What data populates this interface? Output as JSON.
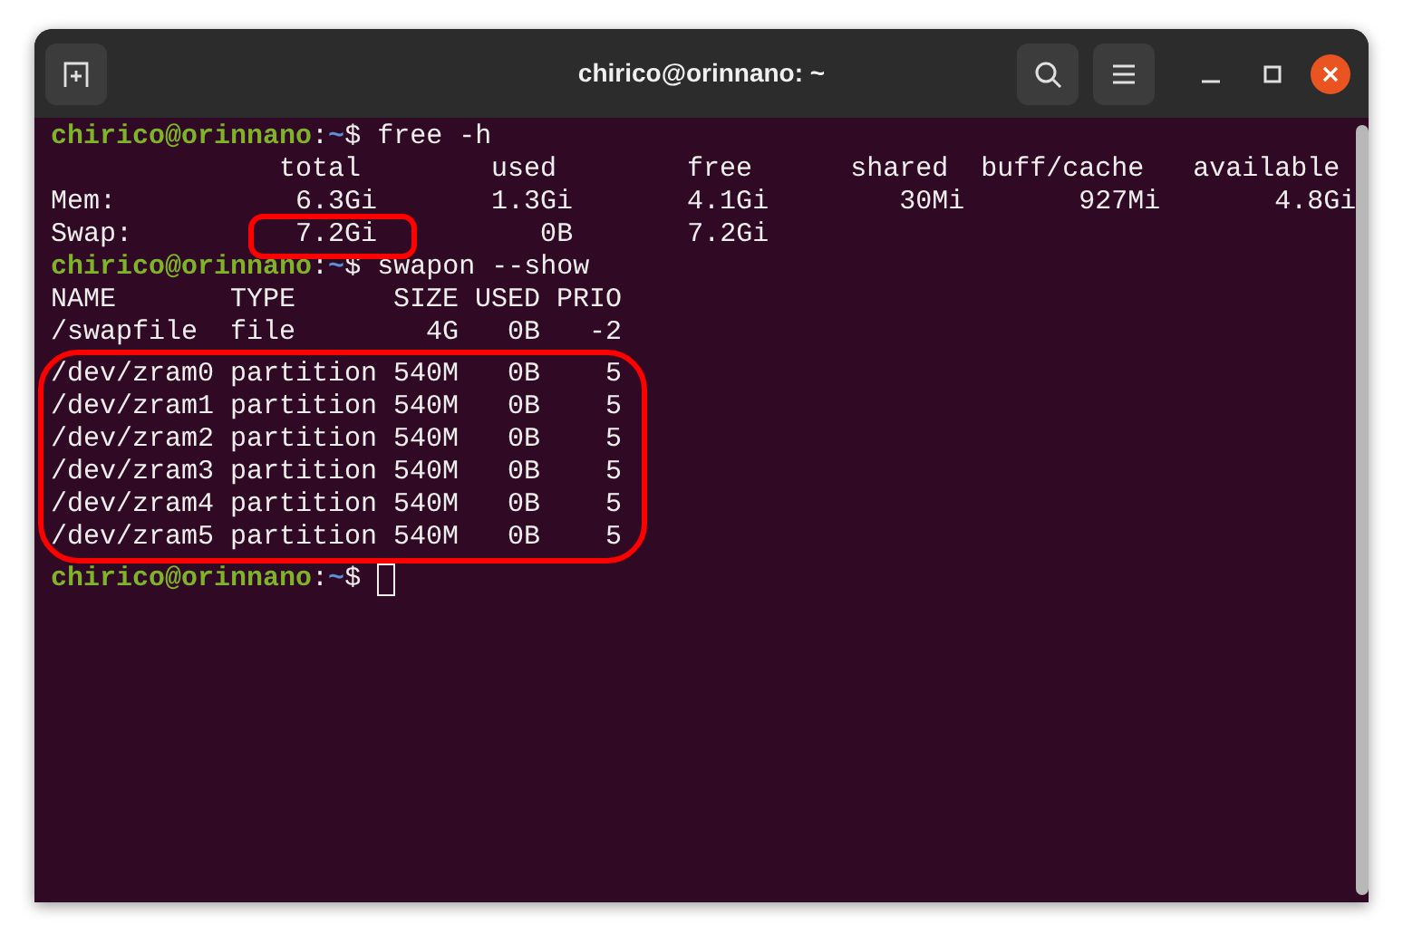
{
  "window": {
    "title": "chirico@orinnano: ~"
  },
  "terminal": {
    "lines": [
      {
        "kind": "prompt",
        "user": "chirico@orinnano",
        "separator": ":",
        "path": "~",
        "symbol": "$",
        "command": " free -h"
      },
      {
        "kind": "output",
        "segments": [
          {
            "text": "              total        used        free      shared  buff/cache   available",
            "circled": false
          }
        ]
      },
      {
        "kind": "output",
        "segments": [
          {
            "text": "Mem:           6.3Gi       1.3Gi       4.1Gi        30Mi       927Mi       4.8Gi",
            "circled": false
          }
        ]
      },
      {
        "kind": "output",
        "segments": [
          {
            "text": "Swap:          ",
            "circled": false
          },
          {
            "text": "7.2Gi",
            "circled": true
          },
          {
            "text": "          0B       7.2Gi",
            "circled": false
          }
        ]
      },
      {
        "kind": "prompt",
        "user": "chirico@orinnano",
        "separator": ":",
        "path": "~",
        "symbol": "$",
        "command": " swapon --show"
      },
      {
        "kind": "output",
        "segments": [
          {
            "text": "NAME       TYPE      SIZE USED PRIO",
            "circled": false
          }
        ]
      },
      {
        "kind": "output",
        "segments": [
          {
            "text": "/swapfile  file        4G   0B   -2",
            "circled": false
          }
        ]
      },
      {
        "kind": "output",
        "circled": true,
        "segments": [
          {
            "text": "/dev/zram0 partition 540M   0B    5",
            "circled": false
          }
        ]
      },
      {
        "kind": "output",
        "circled": true,
        "segments": [
          {
            "text": "/dev/zram1 partition 540M   0B    5",
            "circled": false
          }
        ]
      },
      {
        "kind": "output",
        "circled": true,
        "segments": [
          {
            "text": "/dev/zram2 partition 540M   0B    5",
            "circled": false
          }
        ]
      },
      {
        "kind": "output",
        "circled": true,
        "segments": [
          {
            "text": "/dev/zram3 partition 540M   0B    5",
            "circled": false
          }
        ]
      },
      {
        "kind": "output",
        "circled": true,
        "segments": [
          {
            "text": "/dev/zram4 partition 540M   0B    5",
            "circled": false
          }
        ]
      },
      {
        "kind": "output",
        "circled": true,
        "segments": [
          {
            "text": "/dev/zram5 partition 540M   0B    5",
            "circled": false
          }
        ]
      },
      {
        "kind": "prompt",
        "user": "chirico@orinnano",
        "separator": ":",
        "path": "~",
        "symbol": "$",
        "cursor": true
      }
    ]
  }
}
